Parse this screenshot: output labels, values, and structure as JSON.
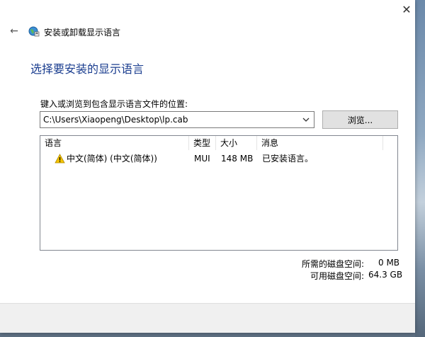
{
  "window": {
    "title": "安装或卸载显示语言",
    "close_glyph": "✕",
    "back_glyph": "←"
  },
  "main": {
    "heading": "选择要安装的显示语言",
    "path_label": "键入或浏览到包含显示语言文件的位置:",
    "path_value": "C:\\Users\\Xiaopeng\\Desktop\\lp.cab",
    "browse_label": "浏览..."
  },
  "table": {
    "columns": [
      "语言",
      "类型",
      "大小",
      "消息"
    ],
    "rows": [
      {
        "language": "中文(简体) (中文(简体))",
        "type": "MUI",
        "size": "148 MB",
        "message": "已安装语言。",
        "icon": "warning-icon"
      }
    ]
  },
  "disk": {
    "required_label": "所需的磁盘空间:",
    "required_value": "0 MB",
    "available_label": "可用磁盘空间:",
    "available_value": "64.3 GB"
  },
  "colors": {
    "heading": "#1a3d8f",
    "warning": "#f5c400"
  }
}
